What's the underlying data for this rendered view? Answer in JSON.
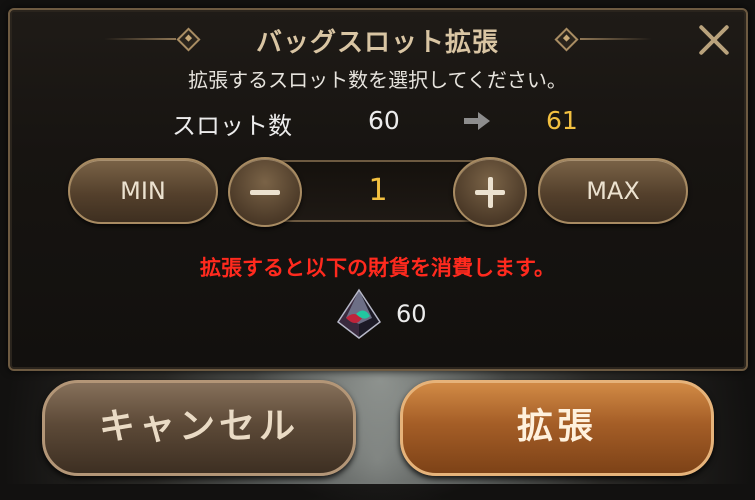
{
  "dialog": {
    "title": "バッグスロット拡張",
    "instruction": "拡張するスロット数を選択してください。",
    "slot_label": "スロット数",
    "current_slots": "60",
    "next_slots": "61",
    "min_label": "MIN",
    "max_label": "MAX",
    "quantity": "1",
    "warning": "拡張すると以下の財貨を消費します。",
    "cost": "60"
  },
  "buttons": {
    "cancel_label": "キャンセル",
    "expand_label": "拡張"
  },
  "colors": {
    "accent_gold": "#f2c040",
    "warning_red": "#ff2a1e",
    "primary_button": "#a55e27",
    "secondary_button": "#5d4a38"
  },
  "icons": {
    "close": "close-icon",
    "arrow": "arrow-right-icon",
    "minus": "minus-icon",
    "plus": "plus-icon",
    "currency": "crystal-gem-icon"
  }
}
